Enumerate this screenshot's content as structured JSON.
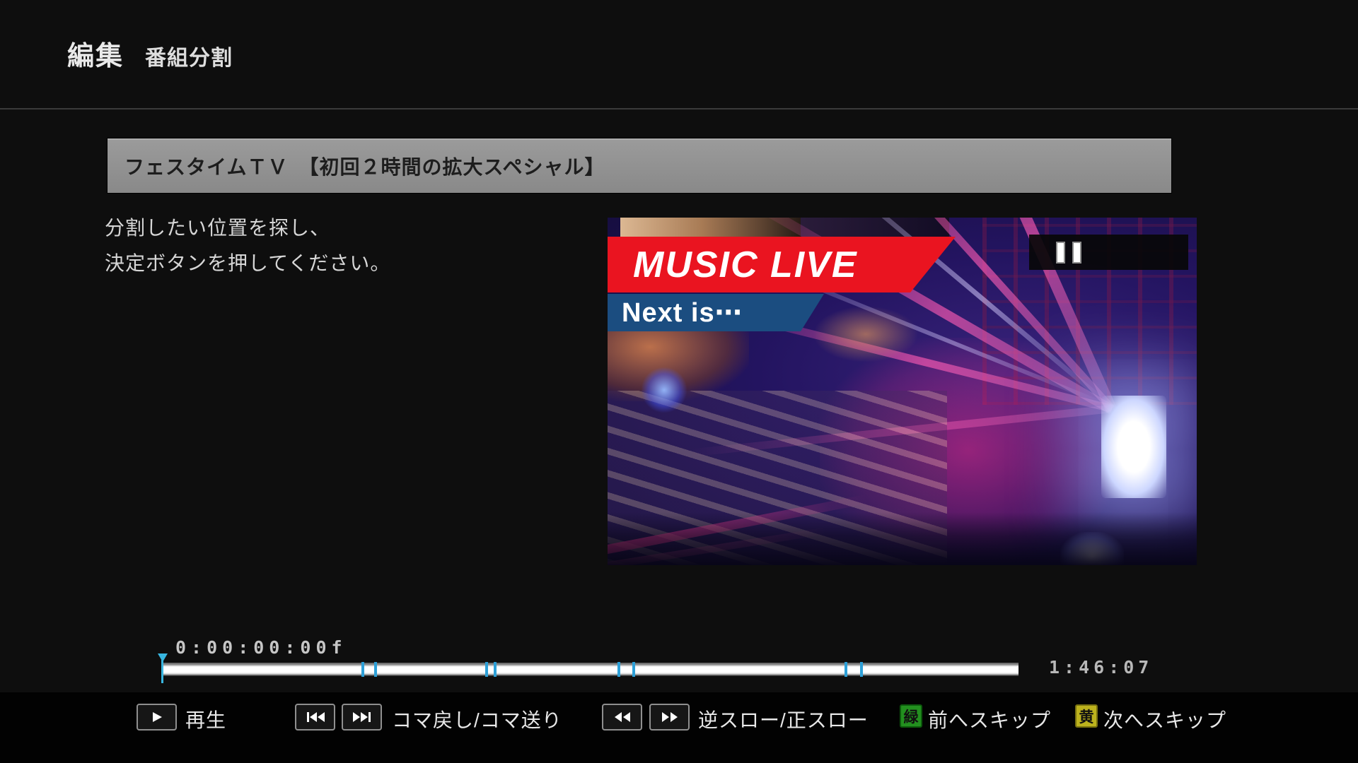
{
  "header": {
    "title": "編集",
    "subtitle": "番組分割"
  },
  "program": {
    "title": "フェスタイムＴＶ　【初回２時間の拡大スペシャル】"
  },
  "instructions": {
    "line1": "分割したい位置を探し、",
    "line2": "決定ボタンを押してください。"
  },
  "video": {
    "state": "paused",
    "banner_primary": "MUSIC LIVE",
    "banner_primary_color": "#ea1420",
    "banner_secondary": "Next is⋯",
    "banner_secondary_color": "#1b4d80"
  },
  "timeline": {
    "current_time": "0:00:00:00f",
    "total_time": "1:46:07",
    "playhead_pct": 0,
    "playhead_color": "#38b6e0",
    "marker_color": "#2da0d8",
    "markers_pct": [
      23.2,
      24.7,
      37.7,
      38.7,
      53.1,
      54.9,
      79.7,
      81.5
    ]
  },
  "controls": {
    "play": {
      "label": "再生",
      "icon": "play-icon"
    },
    "frame": {
      "label": "コマ戻し/コマ送り",
      "icons": [
        "frame-back-icon",
        "frame-forward-icon"
      ]
    },
    "slow": {
      "label": "逆スロー/正スロー",
      "icons": [
        "rewind-icon",
        "fast-forward-icon"
      ]
    },
    "skip_back": {
      "badge": "緑",
      "badge_color": "#23901f",
      "label": "前へスキップ"
    },
    "skip_forward": {
      "badge": "黄",
      "badge_color": "#bcb21d",
      "label": "次へスキップ"
    }
  }
}
